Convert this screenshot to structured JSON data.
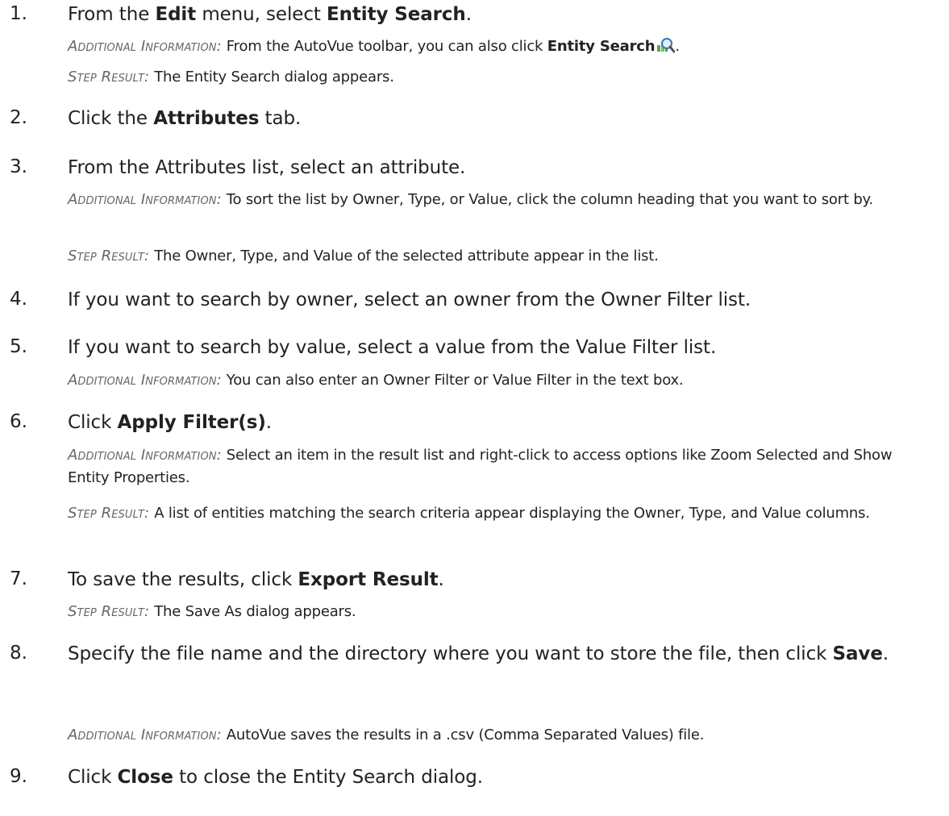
{
  "labels": {
    "additional": "Additional Information:",
    "result": "Step Result:"
  },
  "steps": [
    {
      "num": "1.",
      "pre": "From the ",
      "b1": "Edit",
      "mid": " menu, select ",
      "b2": "Entity Search",
      "post": ".",
      "info1_pre": "From the AutoVue toolbar, you can also click ",
      "info1_bold": "Entity Search",
      "info1_post": ".",
      "result": "The Entity Search dialog appears."
    },
    {
      "num": "2.",
      "pre": "Click the ",
      "b1": "Attributes",
      "post": " tab."
    },
    {
      "num": "3.",
      "text": "From the Attributes list, select an attribute.",
      "info": "To sort the list by Owner, Type, or Value, click the column heading that you want to sort by.",
      "result": "The Owner, Type, and Value of the selected attribute appear in the list."
    },
    {
      "num": "4.",
      "text": "If you want to search by owner, select an owner from the Owner Filter list."
    },
    {
      "num": "5.",
      "text": "If you want to search by value, select a value from the Value Filter list.",
      "info": "You can also enter an Owner Filter or Value Filter in the text box."
    },
    {
      "num": "6.",
      "pre": "Click ",
      "b1": "Apply Filter(s)",
      "post": ".",
      "info": "Select an item in the result list and right-click to access options like Zoom Selected and Show Entity Properties.",
      "result": "A list of entities matching the search criteria appear displaying the Owner, Type, and Value columns."
    },
    {
      "num": "7.",
      "pre": "To save the results, click ",
      "b1": "Export Result",
      "post": ".",
      "result": "The Save As dialog appears."
    },
    {
      "num": "8.",
      "pre": "Specify the file name and the directory where you want to store the file, then click ",
      "b1": "Save",
      "post": ".",
      "info": "AutoVue saves the results in a .csv (Comma Separated Values) file."
    },
    {
      "num": "9.",
      "pre": "Click ",
      "b1": "Close",
      "post": " to close the Entity Search dialog."
    }
  ]
}
